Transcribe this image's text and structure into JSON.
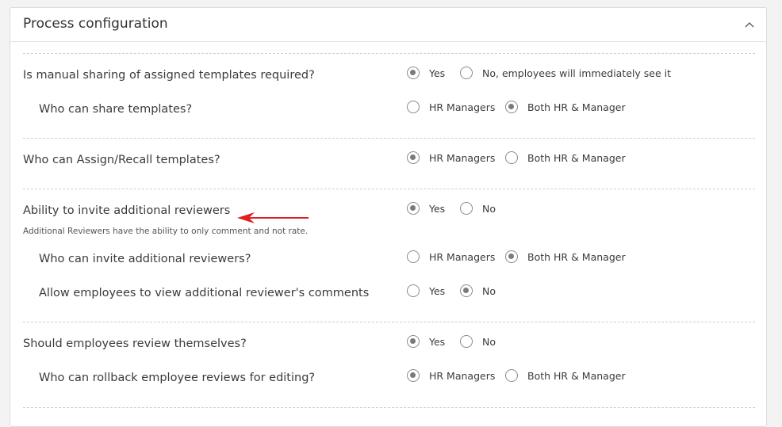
{
  "panel": {
    "title": "Process configuration",
    "toggle_icon": "chevron-up-icon"
  },
  "settings": [
    {
      "question": "Is manual sharing of assigned templates required?",
      "options": [
        {
          "label": "Yes",
          "checked": true
        },
        {
          "label": "No, employees will immediately see it",
          "checked": false
        }
      ]
    },
    {
      "question": "Who can share templates?",
      "options": [
        {
          "label": "HR Managers",
          "checked": false
        },
        {
          "label": "Both HR & Manager",
          "checked": true
        }
      ]
    },
    {
      "question": "Who can Assign/Recall templates?",
      "options": [
        {
          "label": "HR Managers",
          "checked": true
        },
        {
          "label": "Both HR & Manager",
          "checked": false
        }
      ]
    },
    {
      "question": "Ability to invite additional reviewers",
      "hint": "Additional Reviewers have the ability to only comment and not rate.",
      "options": [
        {
          "label": "Yes",
          "checked": true
        },
        {
          "label": "No",
          "checked": false
        }
      ]
    },
    {
      "question": "Who can invite additional reviewers?",
      "options": [
        {
          "label": "HR Managers",
          "checked": false
        },
        {
          "label": "Both HR & Manager",
          "checked": true
        }
      ]
    },
    {
      "question": "Allow employees to view additional reviewer's comments",
      "options": [
        {
          "label": "Yes",
          "checked": false
        },
        {
          "label": "No",
          "checked": true
        }
      ]
    },
    {
      "question": "Should employees review themselves?",
      "options": [
        {
          "label": "Yes",
          "checked": true
        },
        {
          "label": "No",
          "checked": false
        }
      ]
    },
    {
      "question": "Who can rollback employee reviews for editing?",
      "options": [
        {
          "label": "HR Managers",
          "checked": true
        },
        {
          "label": "Both HR & Manager",
          "checked": false
        }
      ]
    }
  ],
  "annotation": {
    "icon": "red-arrow-icon",
    "color": "#e02020"
  }
}
